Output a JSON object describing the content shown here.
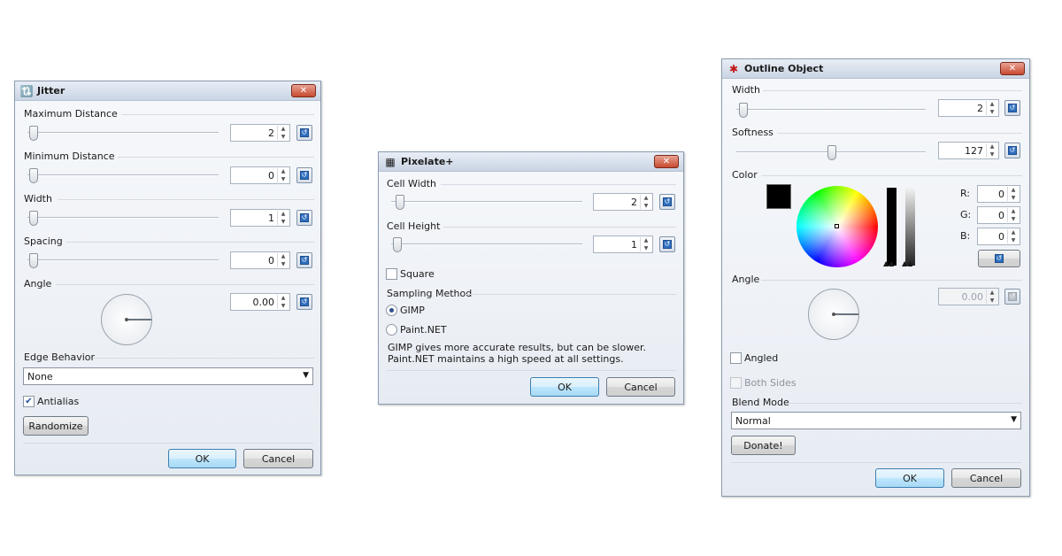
{
  "jitter": {
    "title": "Jitter",
    "max_distance": {
      "label": "Maximum Distance",
      "value": "2"
    },
    "min_distance": {
      "label": "Minimum Distance",
      "value": "0"
    },
    "width": {
      "label": "Width",
      "value": "1"
    },
    "spacing": {
      "label": "Spacing",
      "value": "0"
    },
    "angle": {
      "label": "Angle",
      "value": "0.00"
    },
    "edge_behavior": {
      "label": "Edge Behavior",
      "value": "None"
    },
    "antialias": {
      "label": "Antialias",
      "checked": true
    },
    "randomize_label": "Randomize",
    "ok_label": "OK",
    "cancel_label": "Cancel"
  },
  "pixelate": {
    "title": "Pixelate+",
    "cell_width": {
      "label": "Cell Width",
      "value": "2"
    },
    "cell_height": {
      "label": "Cell Height",
      "value": "1"
    },
    "square": {
      "label": "Square",
      "checked": false
    },
    "sampling_method_label": "Sampling Method",
    "options": [
      "GIMP",
      "Paint.NET"
    ],
    "selected": "GIMP",
    "info_line1": "GIMP gives more accurate results, but can be slower.",
    "info_line2": "Paint.NET maintains a high speed at all settings.",
    "ok_label": "OK",
    "cancel_label": "Cancel"
  },
  "outline": {
    "title": "Outline Object",
    "width": {
      "label": "Width",
      "value": "2"
    },
    "softness": {
      "label": "Softness",
      "value": "127"
    },
    "color_label": "Color",
    "r": {
      "label": "R:",
      "value": "0"
    },
    "g": {
      "label": "G:",
      "value": "0"
    },
    "b": {
      "label": "B:",
      "value": "0"
    },
    "angle": {
      "label": "Angle",
      "value": "0.00"
    },
    "angled": {
      "label": "Angled",
      "checked": false
    },
    "both_sides": {
      "label": "Both Sides",
      "checked": false
    },
    "blend_mode": {
      "label": "Blend Mode",
      "value": "Normal"
    },
    "donate_label": "Donate!",
    "ok_label": "OK",
    "cancel_label": "Cancel"
  },
  "colors": {
    "close": "#c74a2f",
    "default_button": "#3c7fb1",
    "swatch": "#000000"
  }
}
